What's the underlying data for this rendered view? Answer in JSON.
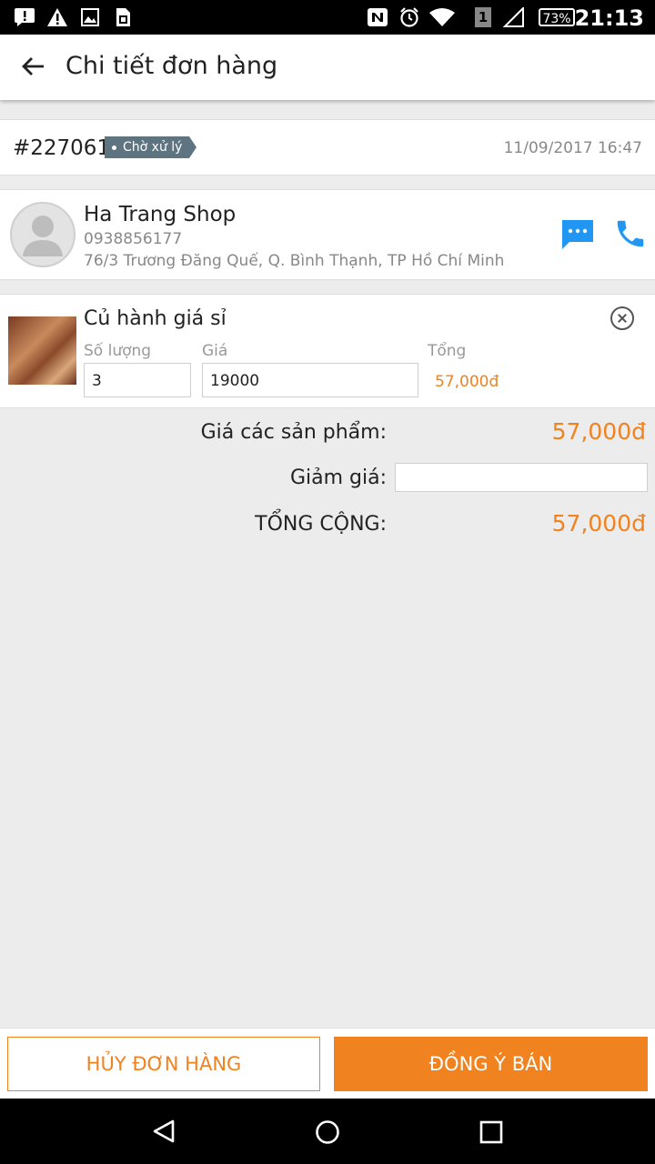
{
  "status_bar": {
    "time": "21:13",
    "battery": "73%",
    "sim_slot": "1",
    "icons": [
      "alert-icon",
      "warning-icon",
      "image-icon",
      "sim-card-icon",
      "nfc-icon",
      "alarm-icon",
      "wifi-icon",
      "signal-icon",
      "battery-icon"
    ]
  },
  "app_bar": {
    "title": "Chi tiết đơn hàng",
    "back_icon": "arrow-back-icon"
  },
  "order": {
    "id": "#227061",
    "status": "Chờ xử lý",
    "datetime": "11/09/2017 16:47"
  },
  "customer": {
    "name": "Ha Trang Shop",
    "phone": "0938856177",
    "address": "76/3 Trương Đăng Quế, Q. Bình Thạnh, TP Hồ Chí Minh",
    "chat_icon": "chat-icon",
    "call_icon": "phone-icon"
  },
  "product": {
    "name": "Củ hành giá sỉ",
    "quantity_label": "Số lượng",
    "quantity": "3",
    "price_label": "Giá",
    "price": "19000",
    "total_label": "Tổng",
    "total": "57,000đ"
  },
  "summary": {
    "subtotal_label": "Giá các sản phẩm:",
    "subtotal": "57,000đ",
    "discount_label": "Giảm giá:",
    "discount": "",
    "grand_total_label": "TỔNG CỘNG:",
    "grand_total": "57,000đ"
  },
  "actions": {
    "cancel": "HỦY ĐƠN HÀNG",
    "accept": "ĐỒNG Ý BÁN"
  },
  "colors": {
    "accent": "#f0821f",
    "status_badge": "#5f7481",
    "icon_blue": "#2196f3"
  }
}
